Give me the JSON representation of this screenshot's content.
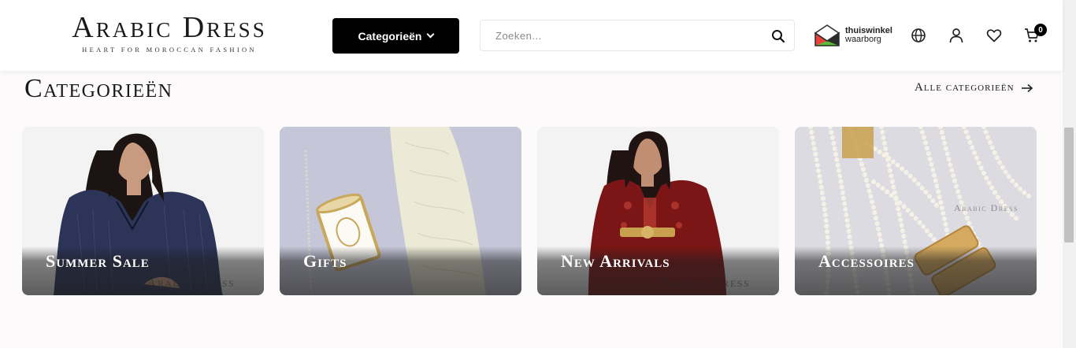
{
  "header": {
    "logo_title": "Arabic Dress",
    "logo_tagline": "HEART FOR MOROCCAN FASHION",
    "categories_button": "Categorieën",
    "search_placeholder": "Zoeken...",
    "trust_badge": {
      "line1": "thuiswinkel",
      "line2": "waarborg"
    },
    "cart_count": "0",
    "icons": [
      "search-icon",
      "globe-icon",
      "account-icon",
      "heart-icon",
      "cart-icon"
    ]
  },
  "section": {
    "title": "Categorieën",
    "all_link": "Alle categorieën"
  },
  "categories": [
    {
      "label": "Summer Sale"
    },
    {
      "label": "Gifts"
    },
    {
      "label": "New Arrivals"
    },
    {
      "label": "Accessoires"
    }
  ],
  "watermarks": {
    "card1": "Arabic Dress",
    "card3": "Arabic Dress",
    "card4": "Arabic Dress"
  },
  "colors": {
    "brand": "#000000",
    "background": "#fcfafa",
    "trust_green": "#5cbb3a",
    "trust_red": "#e8433a"
  }
}
